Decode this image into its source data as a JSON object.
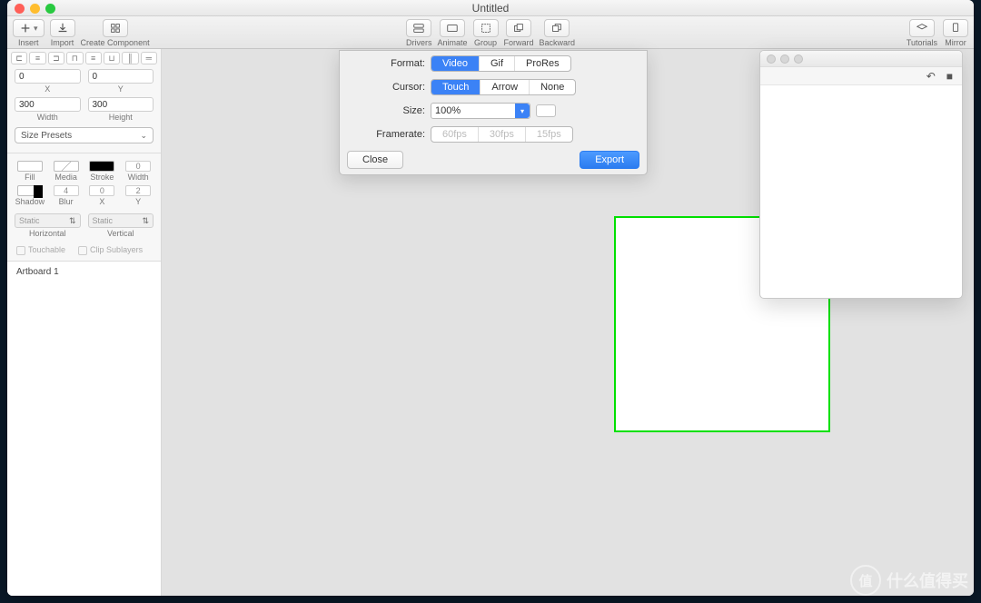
{
  "window": {
    "title": "Untitled"
  },
  "toolbar": {
    "left": [
      {
        "label": "Insert",
        "icon": "plus-icon"
      },
      {
        "label": "Import",
        "icon": "download-icon"
      },
      {
        "label": "Create Component",
        "icon": "component-icon"
      }
    ],
    "center": [
      {
        "label": "Drivers",
        "icon": "drivers-icon"
      },
      {
        "label": "Animate",
        "icon": "animate-icon"
      },
      {
        "label": "Group",
        "icon": "group-icon"
      },
      {
        "label": "Forward",
        "icon": "forward-icon"
      },
      {
        "label": "Backward",
        "icon": "backward-icon"
      }
    ],
    "right": [
      {
        "label": "Tutorials",
        "icon": "tutorials-icon"
      },
      {
        "label": "Mirror",
        "icon": "mirror-icon"
      }
    ]
  },
  "inspector": {
    "x_label": "X",
    "y_label": "Y",
    "x_value": "0",
    "y_value": "0",
    "width_label": "Width",
    "height_label": "Height",
    "width_value": "300",
    "height_value": "300",
    "size_presets_label": "Size Presets",
    "fill_label": "Fill",
    "media_label": "Media",
    "stroke_label": "Stroke",
    "stroke_width_label": "Width",
    "stroke_width_value": "0",
    "shadow_label": "Shadow",
    "blur_label": "Blur",
    "blur_value": "4",
    "sx_label": "X",
    "sx_value": "0",
    "sy_label": "Y",
    "sy_value": "2",
    "h_label": "Horizontal",
    "v_label": "Vertical",
    "static_label": "Static",
    "touchable_label": "Touchable",
    "clip_label": "Clip Sublayers"
  },
  "layers": {
    "artboard_name": "Artboard 1"
  },
  "dialog": {
    "format_label": "Format:",
    "cursor_label": "Cursor:",
    "size_label": "Size:",
    "framerate_label": "Framerate:",
    "format_options": [
      "Video",
      "Gif",
      "ProRes"
    ],
    "format_selected": "Video",
    "cursor_options": [
      "Touch",
      "Arrow",
      "None"
    ],
    "cursor_selected": "Touch",
    "size_value": "100%",
    "framerate_options": [
      "60fps",
      "30fps",
      "15fps"
    ],
    "close_label": "Close",
    "export_label": "Export"
  },
  "watermark": {
    "text": "什么值得买",
    "badge": "值"
  }
}
